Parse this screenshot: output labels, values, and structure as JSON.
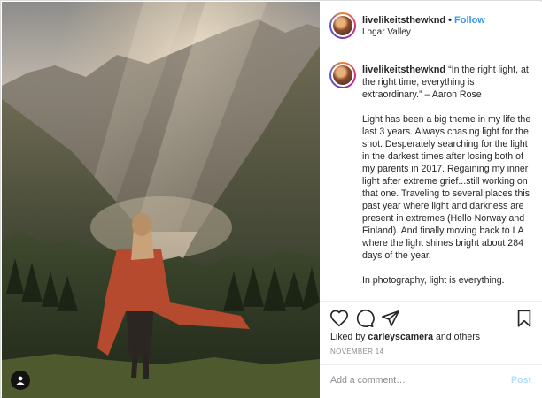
{
  "post": {
    "username": "livelikeitsthewknd",
    "separator": "•",
    "follow_label": "Follow",
    "location": "Logar Valley"
  },
  "caption": {
    "username": "livelikeitsthewknd",
    "quote": "“In the right light, at the right time, everything is extraordinary.” – Aaron Rose",
    "paragraph1": "Light has been a big theme in my life the last 3 years. Always chasing light for the shot. Desperately searching for the light in the darkest times after losing both of my parents in 2017. Regaining my inner light after extreme grief...still working on that one. Traveling to several places this past year where light and darkness are present in extremes (Hello Norway and Finland). And finally moving back to LA where the light shines bright about 284 days of the year.",
    "paragraph2": "In photography, light is everything."
  },
  "engagement": {
    "liked_by_prefix": "Liked by",
    "liked_by_user": "carleyscamera",
    "liked_by_suffix": "and others",
    "date": "NOVEMBER 14"
  },
  "comment": {
    "placeholder": "Add a comment…",
    "post_label": "Post"
  },
  "icons": {
    "heart": "heart-icon",
    "comment": "comment-icon",
    "share": "share-icon",
    "bookmark": "bookmark-icon",
    "user_tag": "user-tag-icon"
  },
  "colors": {
    "follow": "#3897f0",
    "post_disabled": "#b2dffc",
    "muted": "#8e8e8e",
    "text": "#262626"
  }
}
